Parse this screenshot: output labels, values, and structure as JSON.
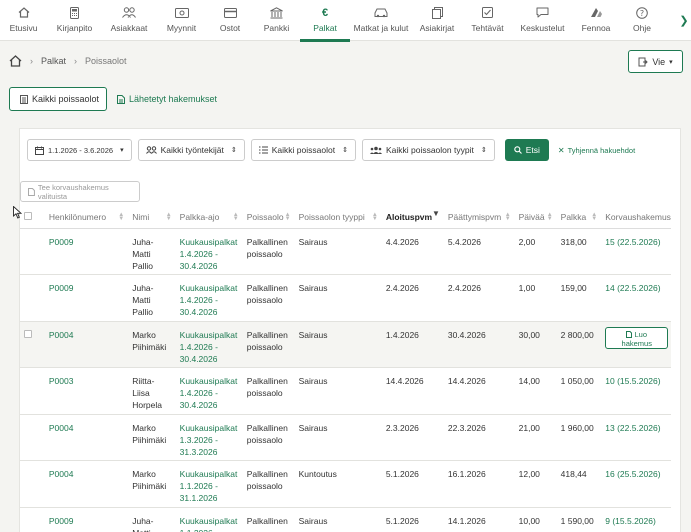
{
  "nav": {
    "items": [
      {
        "label": "Etusivu",
        "icon": "home-icon"
      },
      {
        "label": "Kirjanpito",
        "icon": "calculator-icon"
      },
      {
        "label": "Asiakkaat",
        "icon": "users-icon"
      },
      {
        "label": "Myynnit",
        "icon": "money-icon"
      },
      {
        "label": "Ostot",
        "icon": "card-icon"
      },
      {
        "label": "Pankki",
        "icon": "bank-icon"
      },
      {
        "label": "Palkat",
        "icon": "euro-icon",
        "active": true
      },
      {
        "label": "Matkat ja kulut",
        "icon": "car-icon"
      },
      {
        "label": "Asiakirjat",
        "icon": "documents-icon"
      },
      {
        "label": "Tehtävät",
        "icon": "checkbox-icon"
      },
      {
        "label": "Keskustelut",
        "icon": "chat-icon"
      },
      {
        "label": "Fennoa",
        "icon": "fennoa-logo-icon"
      },
      {
        "label": "Ohje",
        "icon": "help-icon"
      }
    ],
    "accent": "#1e7a52"
  },
  "breadcrumb": {
    "section": "Palkat",
    "current": "Poissaolot"
  },
  "export_button": "Vie",
  "tabs": {
    "all": "Kaikki poissaolot",
    "sent": "Lähetetyt hakemukset"
  },
  "filters": {
    "date_range": "1.1.2026 - 3.6.2026",
    "employees": "Kaikki työntekijät",
    "absences": "Kaikki poissaolot",
    "absence_types": "Kaikki poissaolon tyypit",
    "search": "Etsi",
    "clear": "Tyhjennä hakuehdot"
  },
  "compensation_button": "Tee korvaushakemus valituista",
  "table": {
    "headers": [
      "Henkilönumero",
      "Nimi",
      "Palkka-ajo",
      "Poissaolo",
      "Poissaolon tyyppi",
      "Aloituspvm",
      "Päättymispvm",
      "Päivää",
      "Palkka",
      "Korvaushakemus"
    ],
    "rows": [
      {
        "id": "P0009",
        "name": "Juha-\nMatti\nPallio",
        "run": "Kuukausipalkat",
        "run_dates": "1.4.2026 -\n30.4.2026",
        "absence": "Palkallinen\npoissaolo",
        "type": "Sairaus",
        "start": "4.4.2026",
        "end": "5.4.2026",
        "days": "2,00",
        "salary": "318,00",
        "claim": "15 (22.5.2026)"
      },
      {
        "id": "P0009",
        "name": "Juha-\nMatti\nPallio",
        "run": "Kuukausipalkat",
        "run_dates": "1.4.2026 -\n30.4.2026",
        "absence": "Palkallinen\npoissaolo",
        "type": "Sairaus",
        "start": "2.4.2026",
        "end": "2.4.2026",
        "days": "1,00",
        "salary": "159,00",
        "claim": "14 (22.5.2026)"
      },
      {
        "id": "P0004",
        "name": "Marko\nPiihimäki",
        "run": "Kuukausipalkat",
        "run_dates": "1.4.2026 -\n30.4.2026",
        "absence": "Palkallinen\npoissaolo",
        "type": "Sairaus",
        "start": "1.4.2026",
        "end": "30.4.2026",
        "days": "30,00",
        "salary": "2 800,00",
        "claim": "",
        "create_label": "Luo\nhakemus"
      },
      {
        "id": "P0003",
        "name": "Riitta-\nLiisa\nHorpela",
        "run": "Kuukausipalkat",
        "run_dates": "1.4.2026 -\n30.4.2026",
        "absence": "Palkallinen\npoissaolo",
        "type": "Sairaus",
        "start": "14.4.2026",
        "end": "14.4.2026",
        "days": "14,00",
        "salary": "1 050,00",
        "claim": "10 (15.5.2026)"
      },
      {
        "id": "P0004",
        "name": "Marko\nPiihimäki",
        "run": "Kuukausipalkat",
        "run_dates": "1.3.2026 -\n31.3.2026",
        "absence": "Palkallinen\npoissaolo",
        "type": "Sairaus",
        "start": "2.3.2026",
        "end": "22.3.2026",
        "days": "21,00",
        "salary": "1 960,00",
        "claim": "13 (22.5.2026)"
      },
      {
        "id": "P0004",
        "name": "Marko\nPiihimäki",
        "run": "Kuukausipalkat",
        "run_dates": "1.1.2026 -\n31.1.2026",
        "absence": "Palkallinen\npoissaolo",
        "type": "Kuntoutus",
        "start": "5.1.2026",
        "end": "16.1.2026",
        "days": "12,00",
        "salary": "418,44",
        "claim": "16 (25.5.2026)"
      },
      {
        "id": "P0009",
        "name": "Juha-\nMatti",
        "run": "Kuukausipalkat",
        "run_dates": "1.1.2026 -",
        "absence": "Palkallinen",
        "type": "Sairaus",
        "start": "5.1.2026",
        "end": "14.1.2026",
        "days": "10,00",
        "salary": "1 590,00",
        "claim": "9 (15.5.2026)"
      }
    ]
  }
}
